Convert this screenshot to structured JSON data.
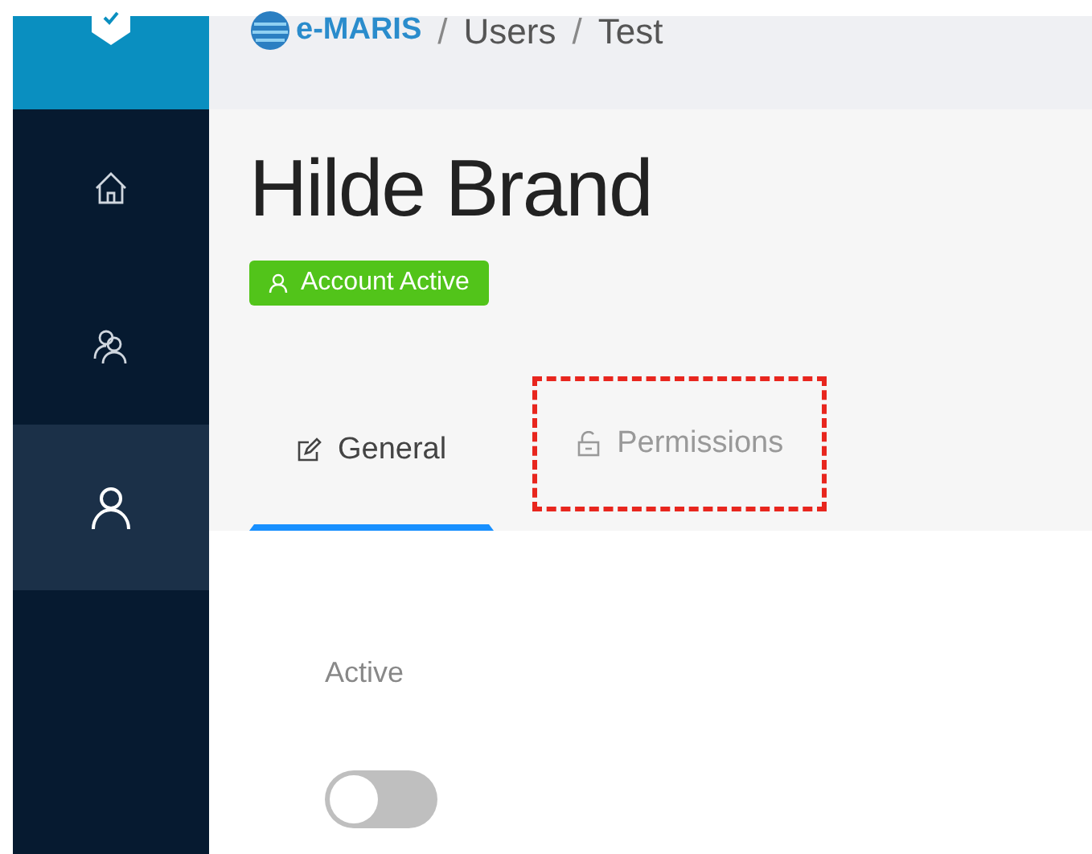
{
  "sidebar": {
    "items": [
      {
        "kind": "home",
        "selected": false
      },
      {
        "kind": "users",
        "selected": false
      },
      {
        "kind": "user",
        "selected": true
      }
    ]
  },
  "breadcrumb": {
    "logo": "e-MARIS",
    "items": [
      {
        "kind": "separator",
        "text": "/"
      },
      {
        "kind": "link",
        "text": "Users"
      },
      {
        "kind": "separator",
        "text": "/"
      },
      {
        "kind": "link",
        "text": "Test"
      }
    ]
  },
  "title": "Hilde Brand",
  "status_badge": {
    "label": "Account Active"
  },
  "tabs": [
    {
      "label": "General",
      "kind": "edit",
      "selected": true,
      "highlighted": false
    },
    {
      "label": "Permissions",
      "kind": "lock",
      "selected": false,
      "highlighted": true
    }
  ],
  "fields": [
    {
      "label": "Active",
      "on": false
    }
  ]
}
